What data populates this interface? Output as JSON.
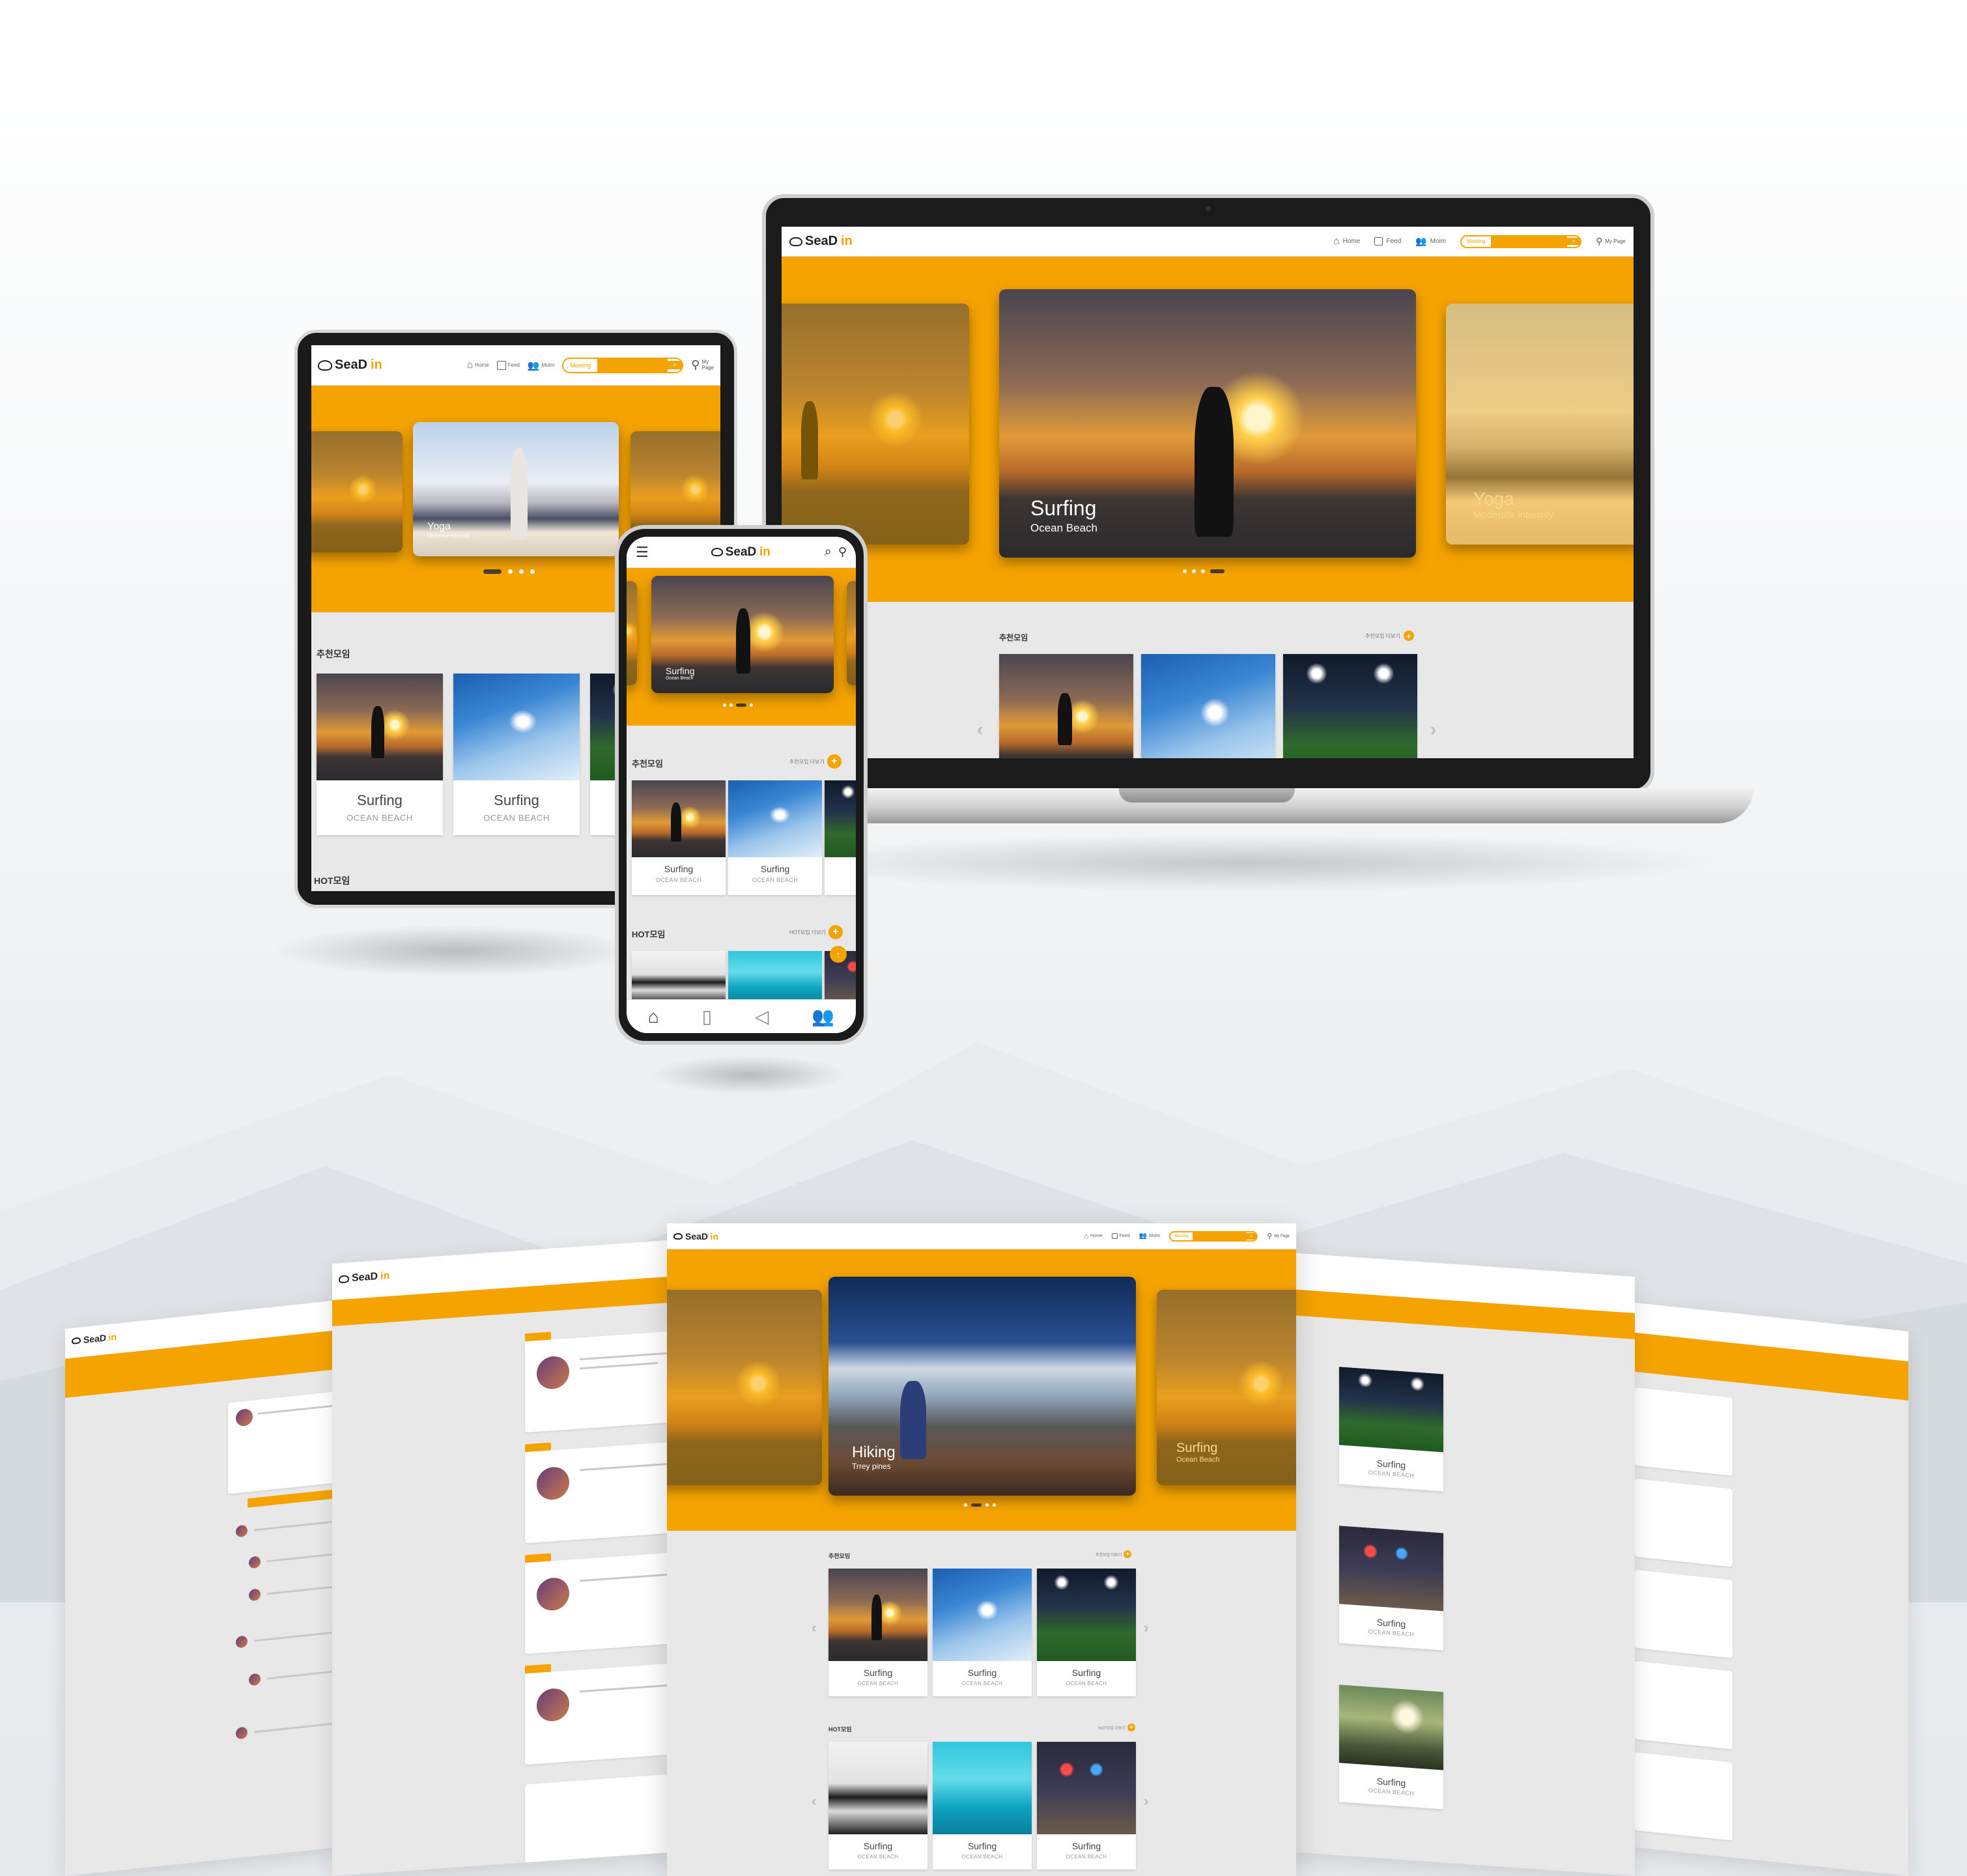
{
  "brand": {
    "name": "SeaD",
    "suffix": "in",
    "accent": "#f5a300"
  },
  "nav": {
    "home": "Home",
    "feed": "Feed",
    "moim": "Moim",
    "search_placeholder": "Meeting",
    "mypage": "My Page",
    "mypage_top": "My",
    "mypage_bottom": "Page"
  },
  "slides": {
    "surfing": {
      "title": "Surfing",
      "subtitle": "Ocean Beach"
    },
    "yoga": {
      "title": "Yoga",
      "subtitle": "Moderate Intensity"
    },
    "hiking": {
      "title": "Hiking",
      "subtitle": "Trrey pines"
    }
  },
  "sections": {
    "recommend": "추천모임",
    "recommend_more": "추천모임 더보기",
    "hot": "HOT모임",
    "hot_more": "HOT모임 더보기"
  },
  "tile": {
    "title": "Surfing",
    "subtitle": "OCEAN BEACH"
  },
  "icons": {
    "menu": "hamburger-icon",
    "search": "search-icon",
    "user": "user-icon",
    "home": "home-icon",
    "feed": "book-icon",
    "notice": "megaphone-icon",
    "moim": "group-icon"
  }
}
